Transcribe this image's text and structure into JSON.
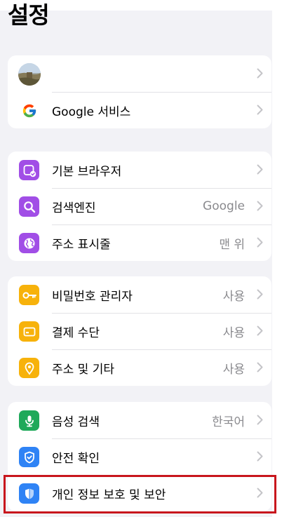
{
  "page": {
    "title": "설정"
  },
  "groups": [
    {
      "rows": [
        {
          "label": "",
          "value": "",
          "icon": "avatar-image"
        },
        {
          "label": "Google 서비스",
          "value": "",
          "icon": "google-g-icon"
        }
      ]
    },
    {
      "rows": [
        {
          "label": "기본 브라우저",
          "value": "",
          "icon": "default-browser-icon",
          "color": "#a14ee6"
        },
        {
          "label": "검색엔진",
          "value": "Google",
          "icon": "search-icon",
          "color": "#a14ee6"
        },
        {
          "label": "주소 표시줄",
          "value": "맨 위",
          "icon": "globe-icon",
          "color": "#a14ee6"
        }
      ]
    },
    {
      "rows": [
        {
          "label": "비밀번호 관리자",
          "value": "사용",
          "icon": "key-icon",
          "color": "#f7b20b"
        },
        {
          "label": "결제 수단",
          "value": "사용",
          "icon": "credit-card-icon",
          "color": "#f7b20b"
        },
        {
          "label": "주소 및 기타",
          "value": "사용",
          "icon": "location-pin-icon",
          "color": "#f7b20b"
        }
      ]
    },
    {
      "rows": [
        {
          "label": "음성 검색",
          "value": "한국어",
          "icon": "microphone-icon",
          "color": "#1fa95a"
        },
        {
          "label": "안전 확인",
          "value": "",
          "icon": "shield-check-icon",
          "color": "#2f83f5"
        },
        {
          "label": "개인 정보 보호 및 보안",
          "value": "",
          "icon": "privacy-shield-icon",
          "color": "#2f83f5"
        }
      ]
    }
  ],
  "highlight_color": "#c8161d"
}
